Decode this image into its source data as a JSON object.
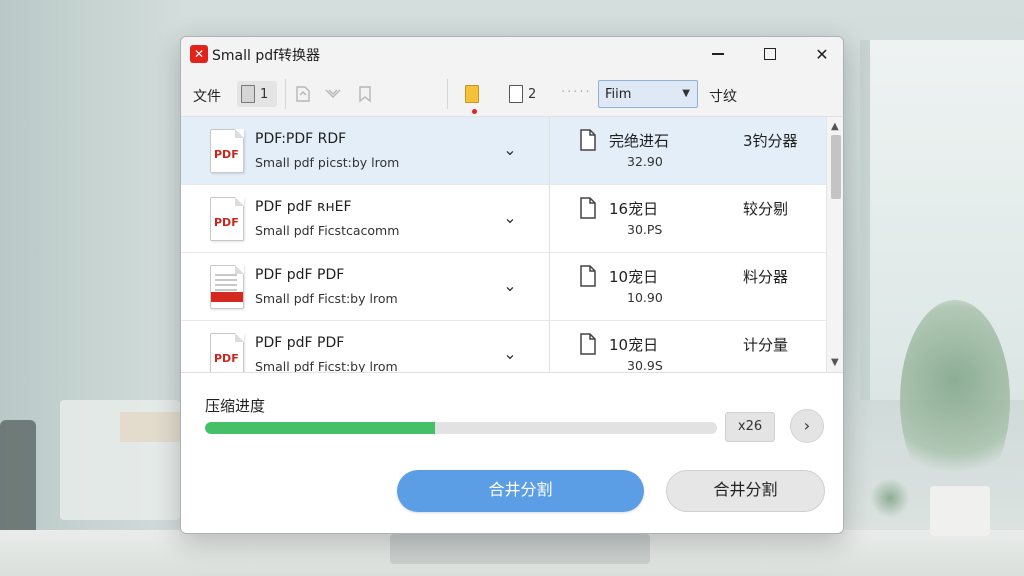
{
  "window": {
    "title": "Small pdf转换器",
    "logo_glyph": "✕",
    "minimize": "",
    "maximize": "",
    "close": "✕"
  },
  "toolbar": {
    "file_label": "文件",
    "page_count_1": "1",
    "page_count_2": "2",
    "dots": "·····",
    "select_value": "Fiim",
    "select_arrow": "⌄",
    "sort_label": "寸纹",
    "accent_color": "#e2231a"
  },
  "files": [
    {
      "name": "PDF:PDF RDF",
      "source": "Small pdf picst:by lrom",
      "status": "完绝进石",
      "size": "32.90",
      "action": "3钓分器",
      "icon": "pdf-doc-icon",
      "selected": true
    },
    {
      "name": "PDF pdF ʀʜEF",
      "source": "Small pdf Ficstcacomm",
      "status": "16宠日",
      "size": "30.PS",
      "action": "较分剔",
      "icon": "pdf-doc-icon",
      "selected": false
    },
    {
      "name": "PDF pdF PDF",
      "source": "Small pdf Ficst:by lrom",
      "status": "10宠日",
      "size": "10.90",
      "action": "料分器",
      "icon": "pdf-red-doc-icon",
      "selected": false
    },
    {
      "name": "PDF pdF PDF",
      "source": "Small pdf Ficst:by lrom",
      "status": "10宠日",
      "size": "30.9S",
      "action": "计分量",
      "icon": "pdf-doc-icon",
      "selected": false
    }
  ],
  "progress": {
    "label": "压缩进度",
    "value": 0.45,
    "count_text": "ⅹ26",
    "next_glyph": "›",
    "fill_color": "#45c068"
  },
  "actions": {
    "primary_label": "合井分割",
    "secondary_label": "合井分割",
    "primary_color": "#5b9ee6"
  }
}
